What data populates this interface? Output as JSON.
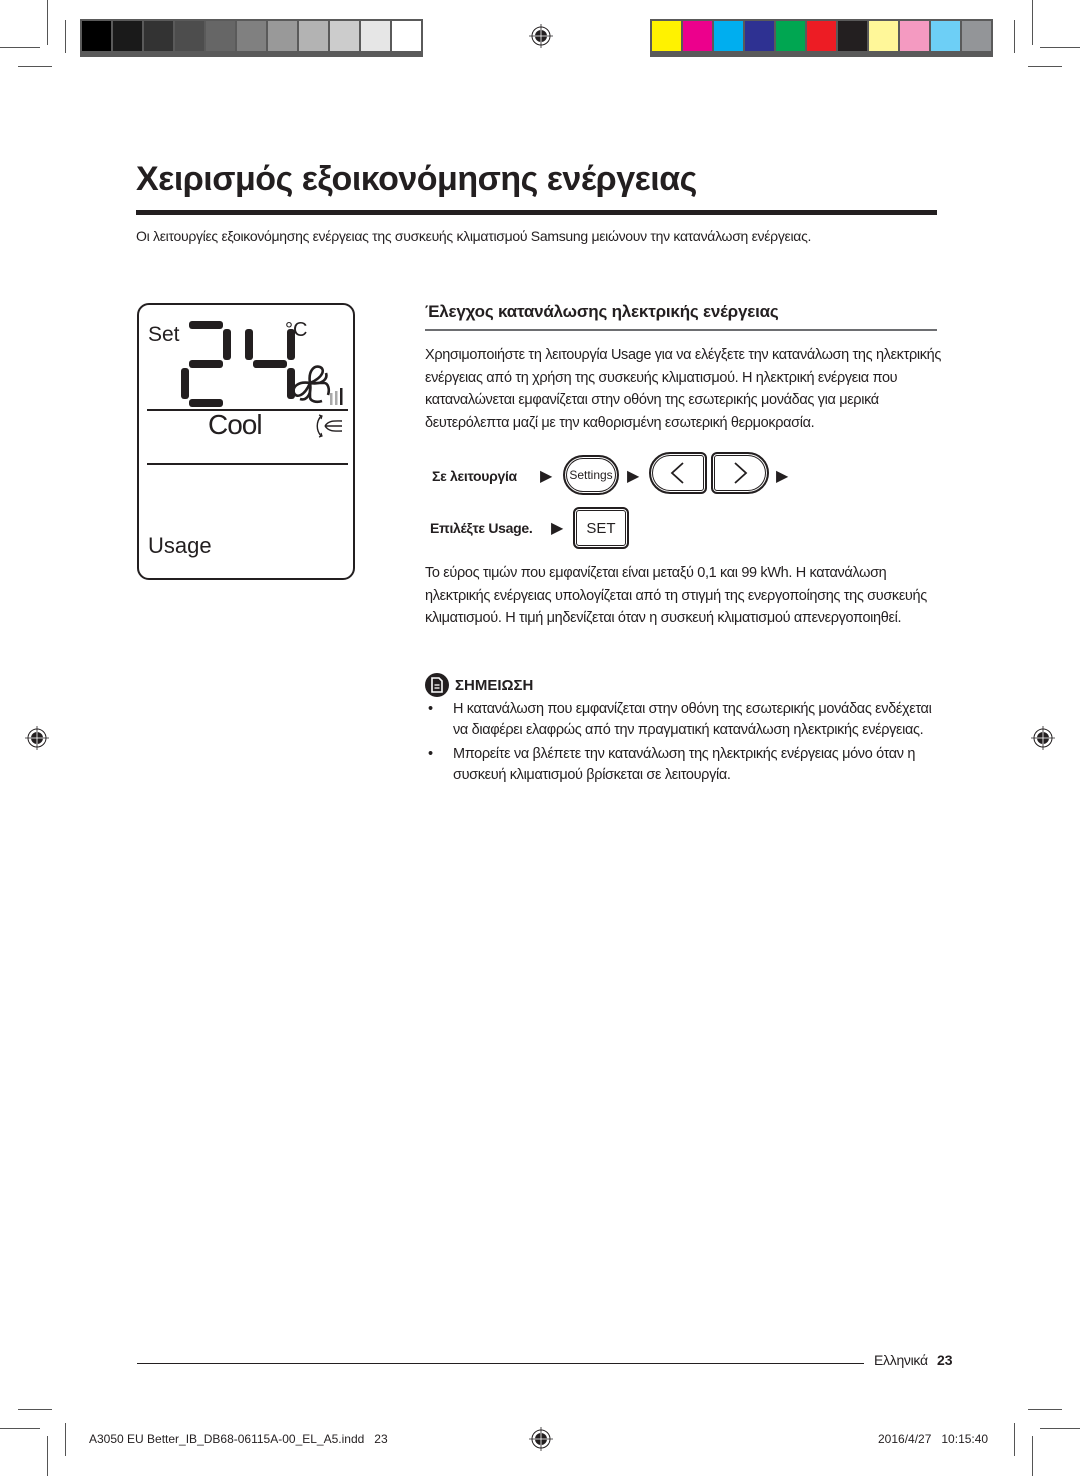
{
  "print_marks": {
    "grayscale_swatches": [
      "#000000",
      "#1a1a1a",
      "#333333",
      "#4d4d4d",
      "#666666",
      "#808080",
      "#999999",
      "#b3b3b3",
      "#cccccc",
      "#e6e6e6",
      "#ffffff"
    ],
    "color_swatches": [
      "#fff200",
      "#ec008c",
      "#00aeef",
      "#2e3192",
      "#00a651",
      "#ed1c24",
      "#231f20",
      "#fff799",
      "#f49ac1",
      "#6dcff6",
      "#939598"
    ]
  },
  "page": {
    "title": "Χειρισμός εξοικονόμησης ενέργειας",
    "intro": "Οι λειτουργίες εξοικονόμησης ενέργειας της συσκευής κλιματισμού Samsung μειώνουν την κατανάλωση ενέργειας."
  },
  "display": {
    "set_label": "Set",
    "temperature": "24",
    "unit": "°C",
    "mode": "Cool",
    "function": "Usage",
    "fan_level_bars": 3,
    "fan_level_active": 1
  },
  "section": {
    "title": "Έλεγχος κατανάλωσης ηλεκτρικής ενέργειας",
    "para1": "Χρησιμοποιήστε τη λειτουργία Usage για να ελέγξετε την κατανάλωση της ηλεκτρικής ενέργειας από τη χρήση της συσκευής κλιματισμού. Η ηλεκτρική ενέργεια που καταναλώνεται εμφανίζεται στην οθόνη της εσωτερικής μονάδας για μερικά δευτερόλεπτα μαζί με την καθορισμένη εσωτερική θερμοκρασία.",
    "step1_label": "Σε λειτουργία",
    "step2_label": "Επιλέξτε Usage.",
    "arrow": "▶",
    "buttons": {
      "settings": "Settings",
      "left": "<",
      "right": ">",
      "set": "SET"
    },
    "para2": "Το εύρος τιμών που εμφανίζεται είναι μεταξύ 0,1 και 99 kWh. Η κατανάλωση ηλεκτρικής ενέργειας υπολογίζεται από τη στιγμή της ενεργοποίησης της συσκευής κλιματισμού. Η τιμή μηδενίζεται όταν η συσκευή κλιματισμού απενεργοποιηθεί."
  },
  "note": {
    "title": "ΣΗΜΕΙΩΣΗ",
    "bullet": "•",
    "items": [
      "Η κατανάλωση που εμφανίζεται στην οθόνη της εσωτερικής μονάδας ενδέχεται να διαφέρει ελαφρώς από την πραγματική κατανάλωση ηλεκτρικής ενέργειας.",
      "Μπορείτε να βλέπετε την κατανάλωση της ηλεκτρικής ενέργειας μόνο όταν η συσκευή κλιματισμού βρίσκεται σε λειτουργία."
    ]
  },
  "footer": {
    "language": "Ελληνικά",
    "page_number": "23",
    "slug_file": "A3050 EU Better_IB_DB68-06115A-00_EL_A5.indd   23",
    "slug_date": "2016/4/27   10:15:40"
  }
}
